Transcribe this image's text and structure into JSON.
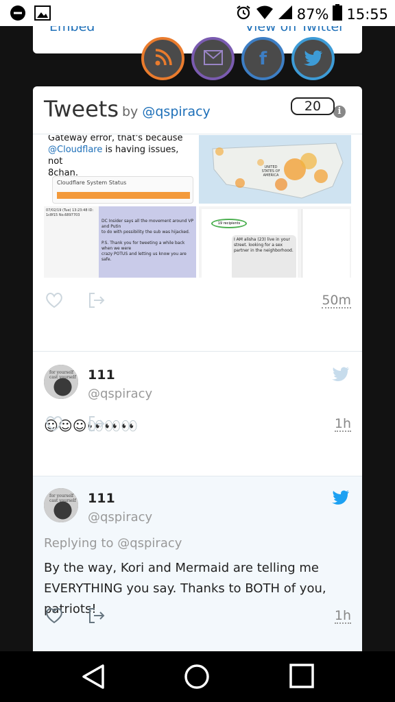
{
  "status_bar": {
    "battery": "87%",
    "time": "15:55"
  },
  "top_card": {
    "embed": "Embed",
    "view_on": "View on Twitter"
  },
  "share": {
    "count": "20"
  },
  "timeline": {
    "title": "Tweets",
    "by": "by",
    "handle": "@qspiracy"
  },
  "tweet1": {
    "text_line1": "Gateway error, that's because",
    "mention": "@Cloudflare",
    "text_line2": " is having issues, not",
    "text_line3": "8chan.",
    "cf_title": "Cloudflare System Status",
    "map_label": "UNITED STATES OF AMERICA",
    "doc_lines": [
      "07/02/19 (Tue) 13:23:48 ID: 1c8f15 No.6897703",
      "DC Insider says all the movement around VP and Putin",
      "to do with possibility the sub was hijacked.",
      "P.S. Thank you for tweeting a while back when we were",
      "crazy POTUS and letting us know you are safe."
    ],
    "phone_recipients": "19 recipients",
    "phone_msg": "I AM alisha (23) live in your street. looking for a sex partner in the neighborhood.",
    "time": "50m"
  },
  "tweet2": {
    "name": "111",
    "handle": "@qspiracy",
    "body": "☺☺☺👀👀👀",
    "time": "1h"
  },
  "tweet3": {
    "name": "111",
    "handle": "@qspiracy",
    "replying": "Replying to @qspiracy",
    "body_line1": "By the way, Kori and Mermaid are telling me",
    "body_line2": "EVERYTHING you say. Thanks to BOTH of you,",
    "body_line3": "patriots!",
    "time": "1h"
  },
  "avatar_caption": "for yourself cast yourself",
  "colors": {
    "link": "#1d6fb8",
    "twitter": "#1da1f2",
    "rss": "#e97b2d",
    "mail": "#7a5bb0",
    "facebook": "#3d7ec4"
  }
}
